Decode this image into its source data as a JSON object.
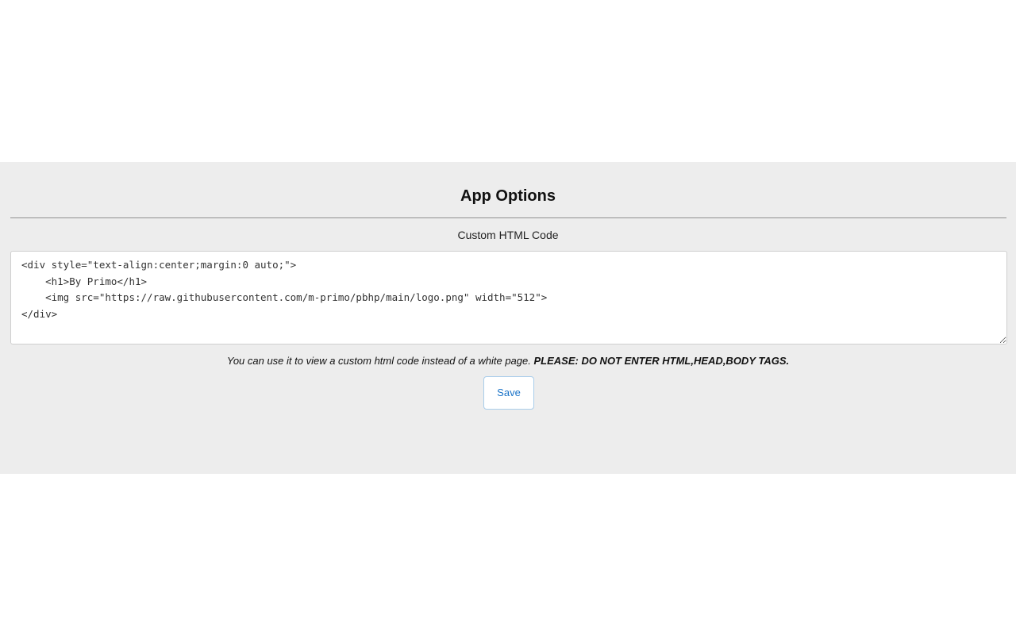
{
  "options": {
    "title": "App Options",
    "field_label": "Custom HTML Code",
    "code_value": "<div style=\"text-align:center;margin:0 auto;\">\n    <h1>By Primo</h1>\n    <img src=\"https://raw.githubusercontent.com/m-primo/pbhp/main/logo.png\" width=\"512\">\n</div>",
    "hint_text": "You can use it to view a custom html code instead of a white page.",
    "hint_warning": "PLEASE: DO NOT ENTER HTML,HEAD,BODY TAGS.",
    "save_label": "Save"
  },
  "colors": {
    "panel_background": "#ededed",
    "button_text": "#1a73c8",
    "button_border": "#a9cdea"
  }
}
